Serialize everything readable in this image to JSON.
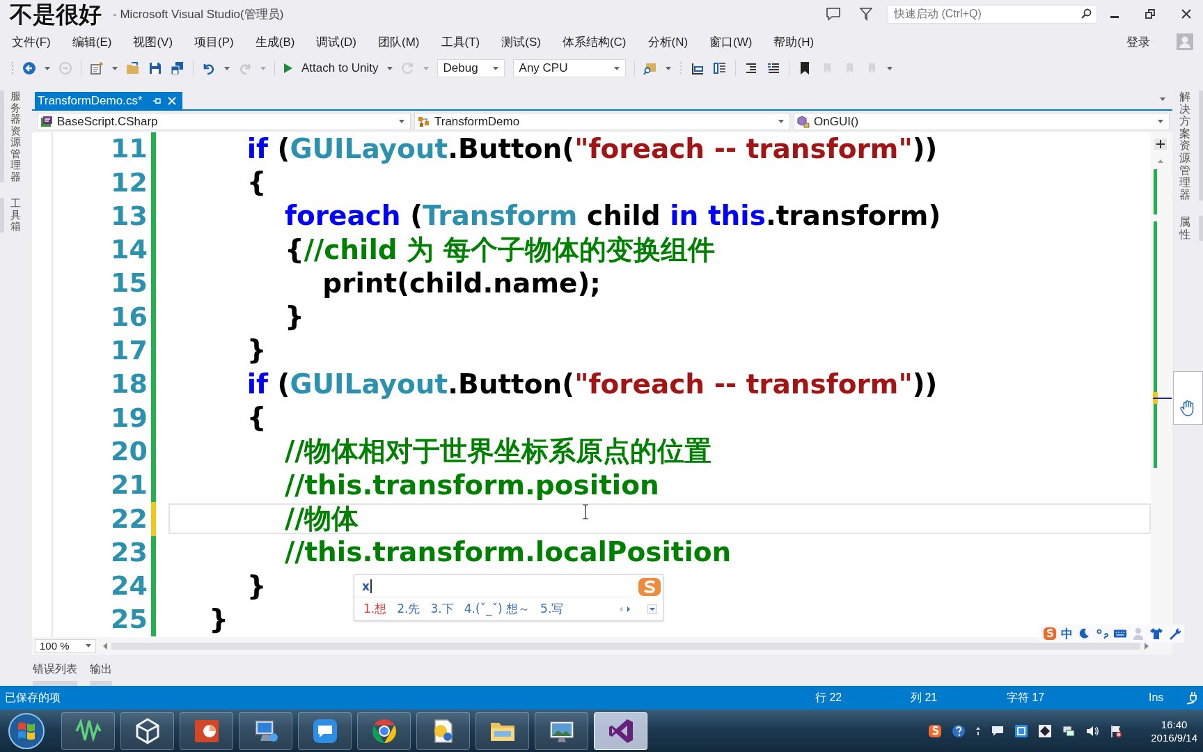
{
  "title_bar": {
    "subtitle": "不是很好",
    "title": "- Microsoft Visual Studio(管理员)",
    "quick_launch": {
      "placeholder": "快速启动 (Ctrl+Q)"
    }
  },
  "menu_bar": {
    "items": [
      "文件(F)",
      "编辑(E)",
      "视图(V)",
      "项目(P)",
      "生成(B)",
      "调试(D)",
      "团队(M)",
      "工具(T)",
      "测试(S)",
      "体系结构(C)",
      "分析(N)",
      "窗口(W)",
      "帮助(H)"
    ],
    "sign_in": "登录"
  },
  "toolbar": {
    "attach": "Attach to Unity",
    "configuration": "Debug",
    "platform": "Any CPU"
  },
  "left_dock": {
    "tabs": [
      "服务器资源管理器",
      "工具箱"
    ]
  },
  "right_dock": {
    "tabs": [
      "解决方案资源管理器",
      "属性"
    ]
  },
  "document_tabs": [
    {
      "label": "TransformDemo.cs*",
      "selected": true
    }
  ],
  "navigation_bar": {
    "project": "BaseScript.CSharp",
    "type": "TransformDemo",
    "member": "OnGUI()"
  },
  "editor": {
    "lines": [
      {
        "number": "11",
        "unsaved": false,
        "current": false,
        "tokens": [
          {
            "kind": "keyword",
            "text": "        if"
          },
          {
            "kind": "plain",
            "text": " ("
          },
          {
            "kind": "type",
            "text": "GUILayout"
          },
          {
            "kind": "plain",
            "text": ".Button("
          },
          {
            "kind": "string",
            "text": "\"foreach -- transform\""
          },
          {
            "kind": "plain",
            "text": "))"
          }
        ]
      },
      {
        "number": "12",
        "unsaved": false,
        "current": false,
        "tokens": [
          {
            "kind": "plain",
            "text": "        {"
          }
        ]
      },
      {
        "number": "13",
        "unsaved": false,
        "current": false,
        "tokens": [
          {
            "kind": "keyword",
            "text": "            foreach"
          },
          {
            "kind": "plain",
            "text": " ("
          },
          {
            "kind": "type",
            "text": "Transform"
          },
          {
            "kind": "plain",
            "text": " child "
          },
          {
            "kind": "keyword",
            "text": "in this"
          },
          {
            "kind": "plain",
            "text": ".transform)"
          }
        ]
      },
      {
        "number": "14",
        "unsaved": false,
        "current": false,
        "tokens": [
          {
            "kind": "plain",
            "text": "            {"
          },
          {
            "kind": "comment",
            "text": "//child 为 每个子物体的变换组件"
          }
        ]
      },
      {
        "number": "15",
        "unsaved": false,
        "current": false,
        "tokens": [
          {
            "kind": "plain",
            "text": "                print(child.name);"
          }
        ]
      },
      {
        "number": "16",
        "unsaved": false,
        "current": false,
        "tokens": [
          {
            "kind": "plain",
            "text": "            }"
          }
        ]
      },
      {
        "number": "17",
        "unsaved": false,
        "current": false,
        "tokens": [
          {
            "kind": "plain",
            "text": "        }"
          }
        ]
      },
      {
        "number": "18",
        "unsaved": false,
        "current": false,
        "tokens": [
          {
            "kind": "keyword",
            "text": "        if"
          },
          {
            "kind": "plain",
            "text": " ("
          },
          {
            "kind": "type",
            "text": "GUILayout"
          },
          {
            "kind": "plain",
            "text": ".Button("
          },
          {
            "kind": "string",
            "text": "\"foreach -- transform\""
          },
          {
            "kind": "plain",
            "text": "))"
          }
        ]
      },
      {
        "number": "19",
        "unsaved": false,
        "current": false,
        "tokens": [
          {
            "kind": "plain",
            "text": "        {"
          }
        ]
      },
      {
        "number": "20",
        "unsaved": false,
        "current": false,
        "tokens": [
          {
            "kind": "comment",
            "text": "            //物体相对于世界坐标系原点的位置"
          }
        ]
      },
      {
        "number": "21",
        "unsaved": false,
        "current": false,
        "tokens": [
          {
            "kind": "comment",
            "text": "            //this.transform.position"
          }
        ]
      },
      {
        "number": "22",
        "unsaved": true,
        "current": true,
        "tokens": [
          {
            "kind": "comment",
            "text": "            //物体"
          }
        ]
      },
      {
        "number": "23",
        "unsaved": false,
        "current": false,
        "tokens": [
          {
            "kind": "comment",
            "text": "            //this.transform.localPosition"
          }
        ]
      },
      {
        "number": "24",
        "unsaved": false,
        "current": false,
        "tokens": [
          {
            "kind": "plain",
            "text": "        }"
          }
        ]
      },
      {
        "number": "25",
        "unsaved": false,
        "current": false,
        "tokens": [
          {
            "kind": "plain",
            "text": "    }"
          }
        ]
      }
    ],
    "zoom": "100 %"
  },
  "ime": {
    "input": "x",
    "candidates": [
      {
        "text": "1.想",
        "selected": true
      },
      {
        "text": "2.先",
        "selected": false
      },
      {
        "text": "3.下",
        "selected": false
      },
      {
        "text": "4.(ˇ_ˇ) 想～",
        "selected": false
      },
      {
        "text": "5.写",
        "selected": false
      }
    ],
    "mode": "中"
  },
  "tool_tabs": [
    "错误列表",
    "输出"
  ],
  "status_bar": {
    "message": "已保存的项",
    "line": "行 22",
    "column": "列 21",
    "character": "字符 17",
    "mode": "Ins"
  },
  "taskbar": {
    "apps": [
      {
        "kind": "waveform",
        "selected": false
      },
      {
        "kind": "cube",
        "selected": false
      },
      {
        "kind": "slides",
        "selected": false
      },
      {
        "kind": "computer",
        "selected": false
      },
      {
        "kind": "chat",
        "selected": false
      },
      {
        "kind": "browser",
        "selected": false
      },
      {
        "kind": "note",
        "selected": false
      },
      {
        "kind": "folder",
        "selected": false
      },
      {
        "kind": "monitor",
        "selected": false
      },
      {
        "kind": "studio",
        "selected": true
      }
    ],
    "time": "16:40",
    "date": "2016/9/14"
  }
}
